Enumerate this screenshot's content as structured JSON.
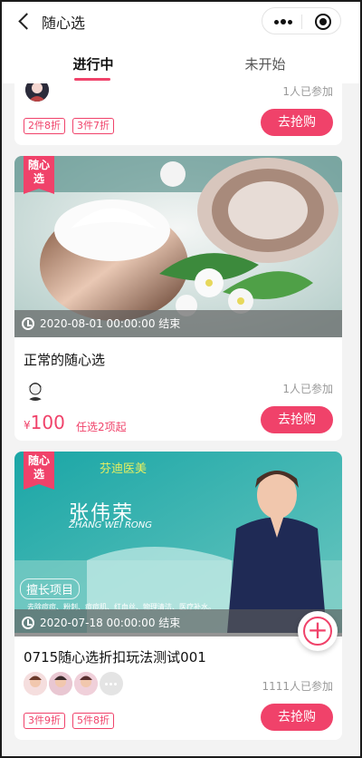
{
  "nav": {
    "title": "随心选",
    "accent": "#f0426a"
  },
  "tabs": [
    {
      "label": "进行中",
      "active": true
    },
    {
      "label": "未开始",
      "active": false
    }
  ],
  "cards": [
    {
      "participants": "1人已参加",
      "tags": [
        "2件8折",
        "3件7折"
      ],
      "button": "去抢购"
    },
    {
      "badge": "随心选",
      "end_time": "2020-08-01 00:00:00 结束",
      "title": "正常的随心选",
      "participants": "1人已参加",
      "price_symbol": "¥",
      "price": "100",
      "price_note": "任选2项起",
      "button": "去抢购"
    },
    {
      "badge": "随心选",
      "brand": "芬迪医美",
      "doctor_name": "张伟荣",
      "doctor_pinyin": "ZHANG WEI RONG",
      "specialty_label": "擅长项目",
      "specialty_text": "去除痘痘、粉刺、痘痘肌、红血丝、物理清洁、医疗补水。",
      "end_time": "2020-07-18 00:00:00 结束",
      "title": "0715随心选折扣玩法测试001",
      "participants": "1111人已参加",
      "tags": [
        "3件9折",
        "5件8折"
      ],
      "button": "去抢购"
    }
  ]
}
